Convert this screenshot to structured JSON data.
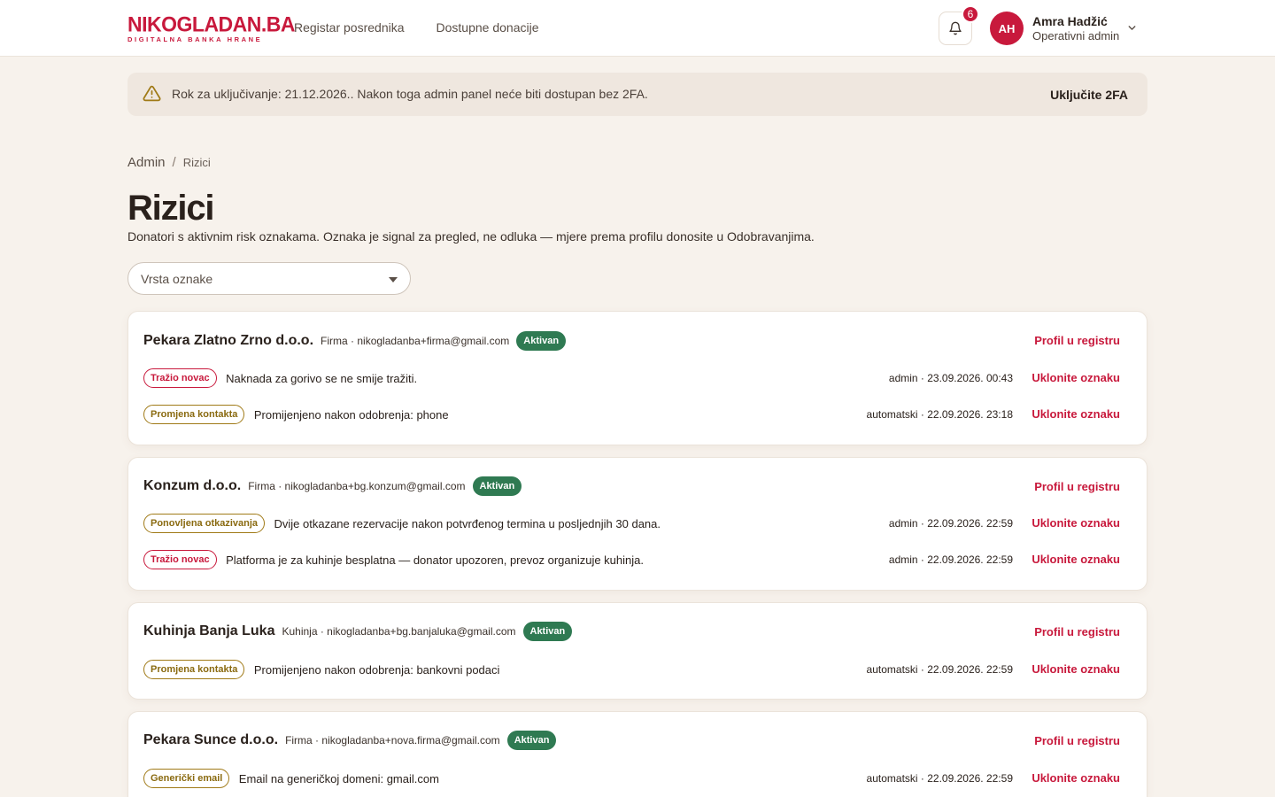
{
  "brand": {
    "name": "NIKOGLADAN.BA",
    "tagline": "DIGITALNA BANKA HRANE"
  },
  "nav": [
    "Registar posrednika",
    "Dostupne donacije"
  ],
  "notifications": {
    "count": "6"
  },
  "user": {
    "initials": "AH",
    "name": "Amra Hadžić",
    "role": "Operativni admin"
  },
  "banner": {
    "text": "Rok za uključivanje: 21.12.2026.. Nakon toga admin panel neće biti dostupan bez 2FA.",
    "action": "Uključite 2FA"
  },
  "breadcrumb": {
    "root": "Admin",
    "sep": "/",
    "current": "Rizici"
  },
  "page": {
    "title": "Rizici",
    "subtitle": "Donatori s aktivnim risk oznakama. Oznaka je signal za pregled, ne odluka — mjere prema profilu donosite u Odobravanjima."
  },
  "filter": {
    "placeholder": "Vrsta oznake"
  },
  "labels": {
    "profile": "Profil u registru",
    "remove": "Uklonite oznaku"
  },
  "colors": {
    "accent": "#c8193c",
    "active": "#2f7a52",
    "gold": "#8a6a10"
  },
  "donors": [
    {
      "name": "Pekara Zlatno Zrno d.o.o.",
      "meta": "Firma · nikogladanba+firma@gmail.com",
      "status": "Aktivan",
      "flags": [
        {
          "tag": "Tražio novac",
          "tone": "red",
          "desc": "Naknada za gorivo se ne smije tražiti.",
          "meta": "admin · 23.09.2026. 00:43"
        },
        {
          "tag": "Promjena kontakta",
          "tone": "gold",
          "desc": "Promijenjeno nakon odobrenja: phone",
          "meta": "automatski · 22.09.2026. 23:18"
        }
      ]
    },
    {
      "name": "Konzum d.o.o.",
      "meta": "Firma · nikogladanba+bg.konzum@gmail.com",
      "status": "Aktivan",
      "flags": [
        {
          "tag": "Ponovljena otkazivanja",
          "tone": "gold",
          "desc": "Dvije otkazane rezervacije nakon potvrđenog termina u posljednjih 30 dana.",
          "meta": "admin · 22.09.2026. 22:59"
        },
        {
          "tag": "Tražio novac",
          "tone": "red",
          "desc": "Platforma je za kuhinje besplatna — donator upozoren, prevoz organizuje kuhinja.",
          "meta": "admin · 22.09.2026. 22:59"
        }
      ]
    },
    {
      "name": "Kuhinja Banja Luka",
      "meta": "Kuhinja · nikogladanba+bg.banjaluka@gmail.com",
      "status": "Aktivan",
      "flags": [
        {
          "tag": "Promjena kontakta",
          "tone": "gold",
          "desc": "Promijenjeno nakon odobrenja: bankovni podaci",
          "meta": "automatski · 22.09.2026. 22:59"
        }
      ]
    },
    {
      "name": "Pekara Sunce d.o.o.",
      "meta": "Firma · nikogladanba+nova.firma@gmail.com",
      "status": "Aktivan",
      "flags": [
        {
          "tag": "Generički email",
          "tone": "gold",
          "desc": "Email na generičkoj domeni: gmail.com",
          "meta": "automatski · 22.09.2026. 22:59"
        }
      ]
    }
  ]
}
